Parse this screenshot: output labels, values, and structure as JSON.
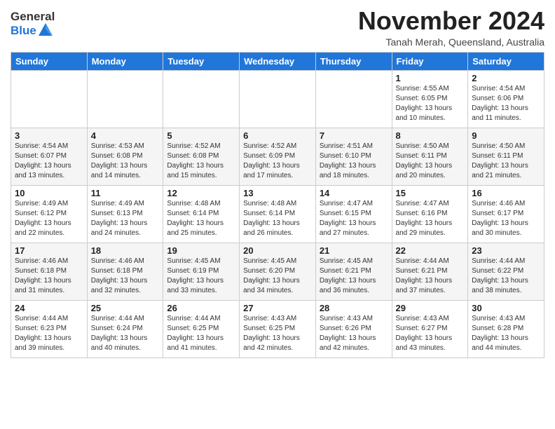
{
  "logo": {
    "general": "General",
    "blue": "Blue"
  },
  "header": {
    "month_year": "November 2024",
    "location": "Tanah Merah, Queensland, Australia"
  },
  "weekdays": [
    "Sunday",
    "Monday",
    "Tuesday",
    "Wednesday",
    "Thursday",
    "Friday",
    "Saturday"
  ],
  "weeks": [
    [
      {
        "day": "",
        "info": ""
      },
      {
        "day": "",
        "info": ""
      },
      {
        "day": "",
        "info": ""
      },
      {
        "day": "",
        "info": ""
      },
      {
        "day": "",
        "info": ""
      },
      {
        "day": "1",
        "info": "Sunrise: 4:55 AM\nSunset: 6:05 PM\nDaylight: 13 hours and 10 minutes."
      },
      {
        "day": "2",
        "info": "Sunrise: 4:54 AM\nSunset: 6:06 PM\nDaylight: 13 hours and 11 minutes."
      }
    ],
    [
      {
        "day": "3",
        "info": "Sunrise: 4:54 AM\nSunset: 6:07 PM\nDaylight: 13 hours and 13 minutes."
      },
      {
        "day": "4",
        "info": "Sunrise: 4:53 AM\nSunset: 6:08 PM\nDaylight: 13 hours and 14 minutes."
      },
      {
        "day": "5",
        "info": "Sunrise: 4:52 AM\nSunset: 6:08 PM\nDaylight: 13 hours and 15 minutes."
      },
      {
        "day": "6",
        "info": "Sunrise: 4:52 AM\nSunset: 6:09 PM\nDaylight: 13 hours and 17 minutes."
      },
      {
        "day": "7",
        "info": "Sunrise: 4:51 AM\nSunset: 6:10 PM\nDaylight: 13 hours and 18 minutes."
      },
      {
        "day": "8",
        "info": "Sunrise: 4:50 AM\nSunset: 6:11 PM\nDaylight: 13 hours and 20 minutes."
      },
      {
        "day": "9",
        "info": "Sunrise: 4:50 AM\nSunset: 6:11 PM\nDaylight: 13 hours and 21 minutes."
      }
    ],
    [
      {
        "day": "10",
        "info": "Sunrise: 4:49 AM\nSunset: 6:12 PM\nDaylight: 13 hours and 22 minutes."
      },
      {
        "day": "11",
        "info": "Sunrise: 4:49 AM\nSunset: 6:13 PM\nDaylight: 13 hours and 24 minutes."
      },
      {
        "day": "12",
        "info": "Sunrise: 4:48 AM\nSunset: 6:14 PM\nDaylight: 13 hours and 25 minutes."
      },
      {
        "day": "13",
        "info": "Sunrise: 4:48 AM\nSunset: 6:14 PM\nDaylight: 13 hours and 26 minutes."
      },
      {
        "day": "14",
        "info": "Sunrise: 4:47 AM\nSunset: 6:15 PM\nDaylight: 13 hours and 27 minutes."
      },
      {
        "day": "15",
        "info": "Sunrise: 4:47 AM\nSunset: 6:16 PM\nDaylight: 13 hours and 29 minutes."
      },
      {
        "day": "16",
        "info": "Sunrise: 4:46 AM\nSunset: 6:17 PM\nDaylight: 13 hours and 30 minutes."
      }
    ],
    [
      {
        "day": "17",
        "info": "Sunrise: 4:46 AM\nSunset: 6:18 PM\nDaylight: 13 hours and 31 minutes."
      },
      {
        "day": "18",
        "info": "Sunrise: 4:46 AM\nSunset: 6:18 PM\nDaylight: 13 hours and 32 minutes."
      },
      {
        "day": "19",
        "info": "Sunrise: 4:45 AM\nSunset: 6:19 PM\nDaylight: 13 hours and 33 minutes."
      },
      {
        "day": "20",
        "info": "Sunrise: 4:45 AM\nSunset: 6:20 PM\nDaylight: 13 hours and 34 minutes."
      },
      {
        "day": "21",
        "info": "Sunrise: 4:45 AM\nSunset: 6:21 PM\nDaylight: 13 hours and 36 minutes."
      },
      {
        "day": "22",
        "info": "Sunrise: 4:44 AM\nSunset: 6:21 PM\nDaylight: 13 hours and 37 minutes."
      },
      {
        "day": "23",
        "info": "Sunrise: 4:44 AM\nSunset: 6:22 PM\nDaylight: 13 hours and 38 minutes."
      }
    ],
    [
      {
        "day": "24",
        "info": "Sunrise: 4:44 AM\nSunset: 6:23 PM\nDaylight: 13 hours and 39 minutes."
      },
      {
        "day": "25",
        "info": "Sunrise: 4:44 AM\nSunset: 6:24 PM\nDaylight: 13 hours and 40 minutes."
      },
      {
        "day": "26",
        "info": "Sunrise: 4:44 AM\nSunset: 6:25 PM\nDaylight: 13 hours and 41 minutes."
      },
      {
        "day": "27",
        "info": "Sunrise: 4:43 AM\nSunset: 6:25 PM\nDaylight: 13 hours and 42 minutes."
      },
      {
        "day": "28",
        "info": "Sunrise: 4:43 AM\nSunset: 6:26 PM\nDaylight: 13 hours and 42 minutes."
      },
      {
        "day": "29",
        "info": "Sunrise: 4:43 AM\nSunset: 6:27 PM\nDaylight: 13 hours and 43 minutes."
      },
      {
        "day": "30",
        "info": "Sunrise: 4:43 AM\nSunset: 6:28 PM\nDaylight: 13 hours and 44 minutes."
      }
    ]
  ]
}
